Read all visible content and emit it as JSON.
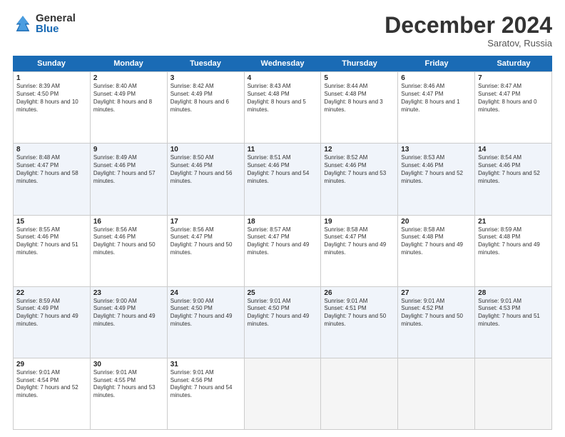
{
  "logo": {
    "general": "General",
    "blue": "Blue"
  },
  "title": "December 2024",
  "subtitle": "Saratov, Russia",
  "days": [
    "Sunday",
    "Monday",
    "Tuesday",
    "Wednesday",
    "Thursday",
    "Friday",
    "Saturday"
  ],
  "weeks": [
    [
      {
        "num": "1",
        "sunrise": "8:39 AM",
        "sunset": "4:50 PM",
        "daylight": "8 hours and 10 minutes."
      },
      {
        "num": "2",
        "sunrise": "8:40 AM",
        "sunset": "4:49 PM",
        "daylight": "8 hours and 8 minutes."
      },
      {
        "num": "3",
        "sunrise": "8:42 AM",
        "sunset": "4:49 PM",
        "daylight": "8 hours and 6 minutes."
      },
      {
        "num": "4",
        "sunrise": "8:43 AM",
        "sunset": "4:48 PM",
        "daylight": "8 hours and 5 minutes."
      },
      {
        "num": "5",
        "sunrise": "8:44 AM",
        "sunset": "4:48 PM",
        "daylight": "8 hours and 3 minutes."
      },
      {
        "num": "6",
        "sunrise": "8:46 AM",
        "sunset": "4:47 PM",
        "daylight": "8 hours and 1 minute."
      },
      {
        "num": "7",
        "sunrise": "8:47 AM",
        "sunset": "4:47 PM",
        "daylight": "8 hours and 0 minutes."
      }
    ],
    [
      {
        "num": "8",
        "sunrise": "8:48 AM",
        "sunset": "4:47 PM",
        "daylight": "7 hours and 58 minutes."
      },
      {
        "num": "9",
        "sunrise": "8:49 AM",
        "sunset": "4:46 PM",
        "daylight": "7 hours and 57 minutes."
      },
      {
        "num": "10",
        "sunrise": "8:50 AM",
        "sunset": "4:46 PM",
        "daylight": "7 hours and 56 minutes."
      },
      {
        "num": "11",
        "sunrise": "8:51 AM",
        "sunset": "4:46 PM",
        "daylight": "7 hours and 54 minutes."
      },
      {
        "num": "12",
        "sunrise": "8:52 AM",
        "sunset": "4:46 PM",
        "daylight": "7 hours and 53 minutes."
      },
      {
        "num": "13",
        "sunrise": "8:53 AM",
        "sunset": "4:46 PM",
        "daylight": "7 hours and 52 minutes."
      },
      {
        "num": "14",
        "sunrise": "8:54 AM",
        "sunset": "4:46 PM",
        "daylight": "7 hours and 52 minutes."
      }
    ],
    [
      {
        "num": "15",
        "sunrise": "8:55 AM",
        "sunset": "4:46 PM",
        "daylight": "7 hours and 51 minutes."
      },
      {
        "num": "16",
        "sunrise": "8:56 AM",
        "sunset": "4:46 PM",
        "daylight": "7 hours and 50 minutes."
      },
      {
        "num": "17",
        "sunrise": "8:56 AM",
        "sunset": "4:47 PM",
        "daylight": "7 hours and 50 minutes."
      },
      {
        "num": "18",
        "sunrise": "8:57 AM",
        "sunset": "4:47 PM",
        "daylight": "7 hours and 49 minutes."
      },
      {
        "num": "19",
        "sunrise": "8:58 AM",
        "sunset": "4:47 PM",
        "daylight": "7 hours and 49 minutes."
      },
      {
        "num": "20",
        "sunrise": "8:58 AM",
        "sunset": "4:48 PM",
        "daylight": "7 hours and 49 minutes."
      },
      {
        "num": "21",
        "sunrise": "8:59 AM",
        "sunset": "4:48 PM",
        "daylight": "7 hours and 49 minutes."
      }
    ],
    [
      {
        "num": "22",
        "sunrise": "8:59 AM",
        "sunset": "4:49 PM",
        "daylight": "7 hours and 49 minutes."
      },
      {
        "num": "23",
        "sunrise": "9:00 AM",
        "sunset": "4:49 PM",
        "daylight": "7 hours and 49 minutes."
      },
      {
        "num": "24",
        "sunrise": "9:00 AM",
        "sunset": "4:50 PM",
        "daylight": "7 hours and 49 minutes."
      },
      {
        "num": "25",
        "sunrise": "9:01 AM",
        "sunset": "4:50 PM",
        "daylight": "7 hours and 49 minutes."
      },
      {
        "num": "26",
        "sunrise": "9:01 AM",
        "sunset": "4:51 PM",
        "daylight": "7 hours and 50 minutes."
      },
      {
        "num": "27",
        "sunrise": "9:01 AM",
        "sunset": "4:52 PM",
        "daylight": "7 hours and 50 minutes."
      },
      {
        "num": "28",
        "sunrise": "9:01 AM",
        "sunset": "4:53 PM",
        "daylight": "7 hours and 51 minutes."
      }
    ],
    [
      {
        "num": "29",
        "sunrise": "9:01 AM",
        "sunset": "4:54 PM",
        "daylight": "7 hours and 52 minutes."
      },
      {
        "num": "30",
        "sunrise": "9:01 AM",
        "sunset": "4:55 PM",
        "daylight": "7 hours and 53 minutes."
      },
      {
        "num": "31",
        "sunrise": "9:01 AM",
        "sunset": "4:56 PM",
        "daylight": "7 hours and 54 minutes."
      },
      null,
      null,
      null,
      null
    ]
  ],
  "labels": {
    "sunrise": "Sunrise:",
    "sunset": "Sunset:",
    "daylight": "Daylight:"
  }
}
